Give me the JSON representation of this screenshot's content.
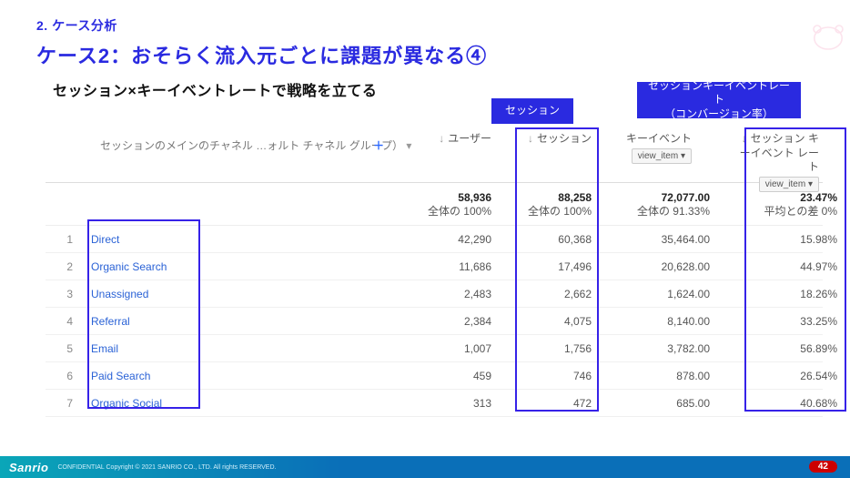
{
  "eyebrow": "2. ケース分析",
  "title": "ケース2：おそらく流入元ごとに課題が異なる④",
  "subtitle": "セッション×キーイベントレートで戦略を立てる",
  "box_session": "セッション",
  "box_conv": "セッションキーイベントレート\n（コンバージョン率）",
  "dim_label": "セッションのメインのチャネル …ォルト チャネル グループ）",
  "plus": "＋",
  "headers": {
    "user": "ユーザー",
    "session": "セッション",
    "keyevent": "キーイベント",
    "keyevent_dd": "view_item ▾",
    "rate": "セッション キーイベント レート",
    "rate_dd": "view_item ▾"
  },
  "totals": {
    "user": {
      "v": "58,936",
      "sub": "全体の 100%"
    },
    "session": {
      "v": "88,258",
      "sub": "全体の 100%"
    },
    "keyevent": {
      "v": "72,077.00",
      "sub": "全体の 91.33%"
    },
    "rate": {
      "v": "23.47%",
      "sub": "平均との差 0%"
    }
  },
  "rows": [
    {
      "idx": "1",
      "name": "Direct",
      "user": "42,290",
      "session": "60,368",
      "keyevent": "35,464.00",
      "rate": "15.98%"
    },
    {
      "idx": "2",
      "name": "Organic Search",
      "user": "11,686",
      "session": "17,496",
      "keyevent": "20,628.00",
      "rate": "44.97%"
    },
    {
      "idx": "3",
      "name": "Unassigned",
      "user": "2,483",
      "session": "2,662",
      "keyevent": "1,624.00",
      "rate": "18.26%"
    },
    {
      "idx": "4",
      "name": "Referral",
      "user": "2,384",
      "session": "4,075",
      "keyevent": "8,140.00",
      "rate": "33.25%"
    },
    {
      "idx": "5",
      "name": "Email",
      "user": "1,007",
      "session": "1,756",
      "keyevent": "3,782.00",
      "rate": "56.89%"
    },
    {
      "idx": "6",
      "name": "Paid Search",
      "user": "459",
      "session": "746",
      "keyevent": "878.00",
      "rate": "26.54%"
    },
    {
      "idx": "7",
      "name": "Organic Social",
      "user": "313",
      "session": "472",
      "keyevent": "685.00",
      "rate": "40.68%"
    }
  ],
  "footer": {
    "logo": "Sanrio",
    "conf": "CONFIDENTIAL Copyright © 2021 SANRIO CO., LTD. All rights RESERVED."
  },
  "page": "42",
  "chart_data": {
    "type": "table",
    "columns": [
      "Channel",
      "ユーザー",
      "セッション",
      "キーイベント(view_item)",
      "セッション キーイベント レート"
    ],
    "totals": [
      "",
      58936,
      88258,
      72077.0,
      23.47
    ],
    "rows": [
      [
        "Direct",
        42290,
        60368,
        35464.0,
        15.98
      ],
      [
        "Organic Search",
        11686,
        17496,
        20628.0,
        44.97
      ],
      [
        "Unassigned",
        2483,
        2662,
        1624.0,
        18.26
      ],
      [
        "Referral",
        2384,
        4075,
        8140.0,
        33.25
      ],
      [
        "Email",
        1007,
        1756,
        3782.0,
        56.89
      ],
      [
        "Paid Search",
        459,
        746,
        878.0,
        26.54
      ],
      [
        "Organic Social",
        313,
        472,
        685.0,
        40.68
      ]
    ]
  }
}
